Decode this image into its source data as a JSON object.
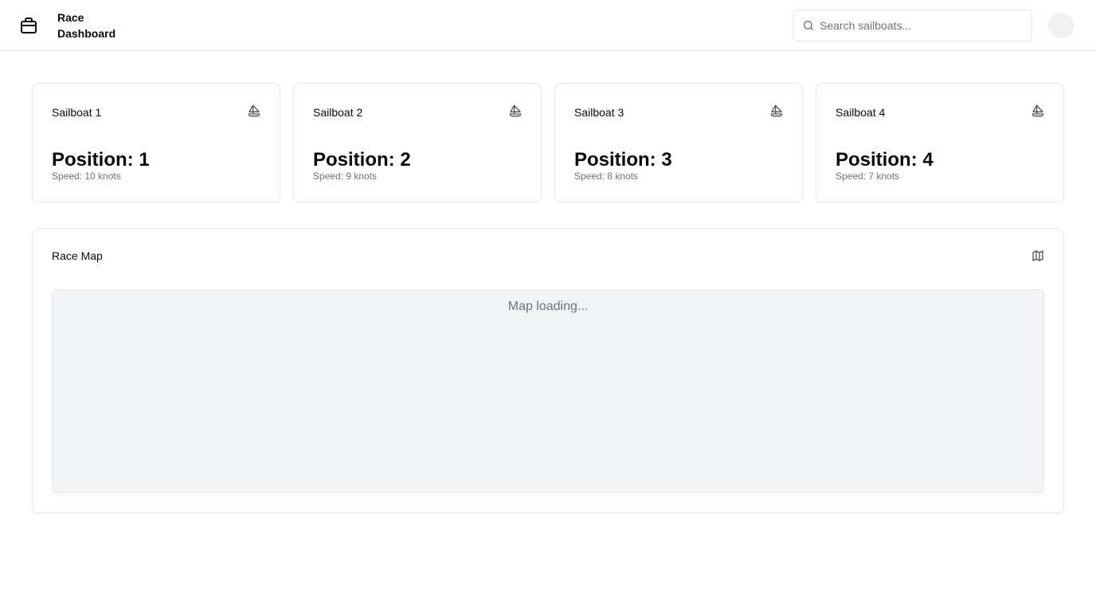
{
  "header": {
    "brand_line1": "Race",
    "brand_line2": "Dashboard",
    "logo_icon": "package-icon",
    "search_placeholder": "Search sailboats...",
    "search_value": ""
  },
  "boats": [
    {
      "name": "Sailboat 1",
      "position": "Position: 1",
      "speed": "Speed: 10 knots",
      "icon": "sailboat-icon"
    },
    {
      "name": "Sailboat 2",
      "position": "Position: 2",
      "speed": "Speed: 9 knots",
      "icon": "sailboat-icon"
    },
    {
      "name": "Sailboat 3",
      "position": "Position: 3",
      "speed": "Speed: 8 knots",
      "icon": "sailboat-icon"
    },
    {
      "name": "Sailboat 4",
      "position": "Position: 4",
      "speed": "Speed: 7 knots",
      "icon": "sailboat-icon"
    }
  ],
  "map": {
    "title": "Race Map",
    "icon": "map-icon",
    "loading_text": "Map loading..."
  },
  "colors": {
    "border": "#e5e7eb",
    "muted_text": "#71717a",
    "map_bg": "#f2f3f5"
  }
}
